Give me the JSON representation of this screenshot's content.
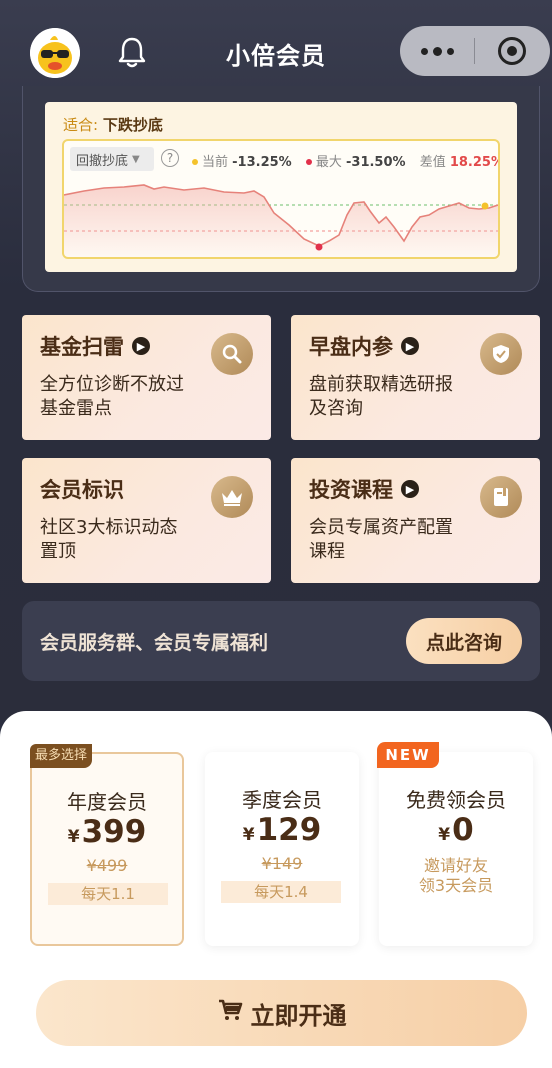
{
  "header": {
    "title": "小倍会员",
    "icons": [
      "avatar",
      "bell-icon",
      "more-icon",
      "close-capsule-icon"
    ]
  },
  "chart": {
    "suitable_label": "适合:",
    "suitable_value": "下跌抄底",
    "dropdown_label": "回撤抄底",
    "help_icon": "?",
    "legend": {
      "current_label": "当前",
      "current_value": "-13.25%",
      "max_label": "最大",
      "max_value": "-31.50%",
      "diff_label": "差值",
      "diff_value": "18.25%"
    },
    "colors": {
      "line": "#e6827a",
      "current_dot": "#f4c22b",
      "max_dot": "#e2304a",
      "dash_green": "#6cbf6c",
      "dash_red": "#f08a8a"
    }
  },
  "features": [
    {
      "title": "基金扫雷",
      "has_arrow": true,
      "desc": "全方位诊断不放过基金雷点",
      "icon": "magnifier-icon"
    },
    {
      "title": "早盘内参",
      "has_arrow": true,
      "desc": "盘前获取精选研报及咨询",
      "icon": "shield-check-icon"
    },
    {
      "title": "会员标识",
      "has_arrow": false,
      "desc": "社区3大标识动态置顶",
      "icon": "crown-icon"
    },
    {
      "title": "投资课程",
      "has_arrow": true,
      "desc": "会员专属资产配置课程",
      "icon": "book-icon"
    }
  ],
  "consult": {
    "text": "会员服务群、会员专属福利",
    "button": "点此咨询"
  },
  "plans": [
    {
      "badge": "最多选择",
      "name": "年度会员",
      "currency": "¥",
      "price": "399",
      "original": "¥499",
      "daily": "每天1.1"
    },
    {
      "name": "季度会员",
      "currency": "¥",
      "price": "129",
      "original": "¥149",
      "daily": "每天1.4"
    },
    {
      "badge": "NEW",
      "name": "免费领会员",
      "currency": "¥",
      "price": "0",
      "invite_line1": "邀请好友",
      "invite_line2": "领3天会员"
    }
  ],
  "cta": {
    "label": "立即开通",
    "icon": "cart-icon"
  }
}
